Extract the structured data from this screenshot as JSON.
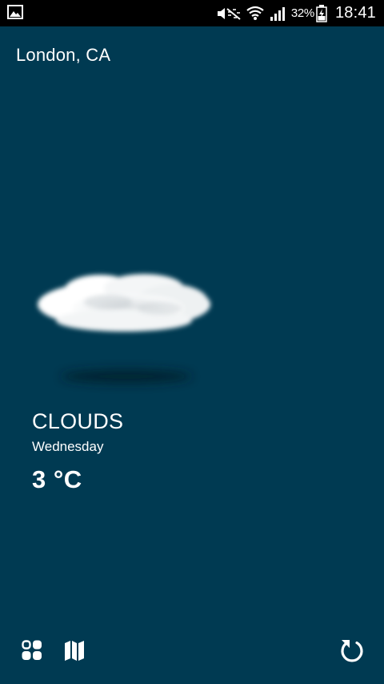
{
  "status_bar": {
    "icons": [
      "gallery-icon",
      "mute-icon",
      "wifi-icon",
      "signal-icon",
      "battery-icon"
    ],
    "battery_percent": "32%",
    "time": "18:41"
  },
  "location": "London, CA",
  "weather": {
    "condition": "CLOUDS",
    "day": "Wednesday",
    "temperature": "3 °C",
    "icon": "cloud-icon"
  },
  "toolbar": {
    "icons": [
      "grid-icon",
      "map-icon",
      "refresh-icon"
    ]
  },
  "colors": {
    "background": "#003a52",
    "status_bar": "#000000",
    "text": "#ffffff"
  }
}
